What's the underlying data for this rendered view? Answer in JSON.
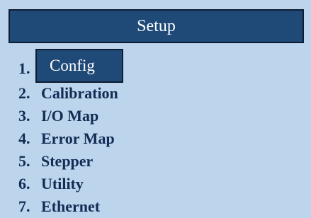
{
  "header": {
    "title": "Setup"
  },
  "menu": {
    "items": [
      {
        "number": "1.",
        "label": "Config",
        "selected": true
      },
      {
        "number": "2.",
        "label": "Calibration",
        "selected": false
      },
      {
        "number": "3.",
        "label": "I/O Map",
        "selected": false
      },
      {
        "number": "4.",
        "label": "Error Map",
        "selected": false
      },
      {
        "number": "5.",
        "label": "Stepper",
        "selected": false
      },
      {
        "number": "6.",
        "label": "Utility",
        "selected": false
      },
      {
        "number": "7.",
        "label": "Ethernet",
        "selected": false
      }
    ]
  },
  "colors": {
    "background": "#bcd5ec",
    "title_bar": "#1f4a78",
    "selected_fill": "#1f4a78",
    "menu_text": "#142b55",
    "selected_text": "#ffffff"
  }
}
